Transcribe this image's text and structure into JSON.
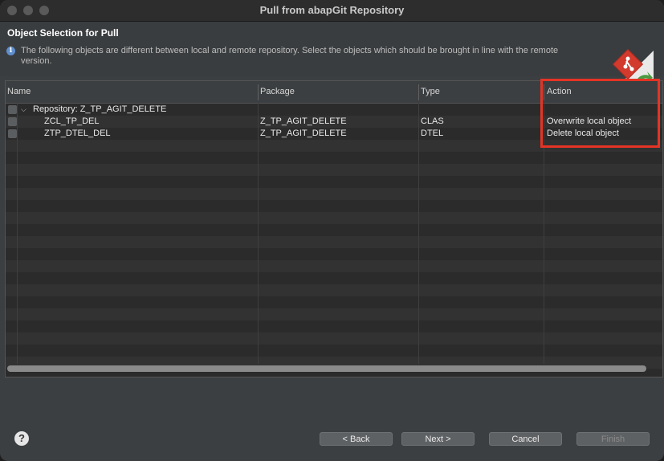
{
  "window": {
    "title": "Pull from abapGit Repository"
  },
  "header": {
    "title": "Object Selection for Pull",
    "description": "The following objects are different between local and remote repository. Select the objects which should be brought in line with the remote version."
  },
  "table": {
    "columns": [
      "Name",
      "Package",
      "Type",
      "Action"
    ],
    "repository_label": "Repository: Z_TP_AGIT_DELETE",
    "rows": [
      {
        "name": "ZCL_TP_DEL",
        "package": "Z_TP_AGIT_DELETE",
        "type": "CLAS",
        "action": "Overwrite local object"
      },
      {
        "name": "ZTP_DTEL_DEL",
        "package": "Z_TP_AGIT_DELETE",
        "type": "DTEL",
        "action": "Delete local object"
      }
    ]
  },
  "buttons": {
    "back": "< Back",
    "next": "Next >",
    "cancel": "Cancel",
    "finish": "Finish"
  },
  "help_label": "?",
  "colors": {
    "highlight": "#e53426",
    "background": "#3c3f41"
  }
}
